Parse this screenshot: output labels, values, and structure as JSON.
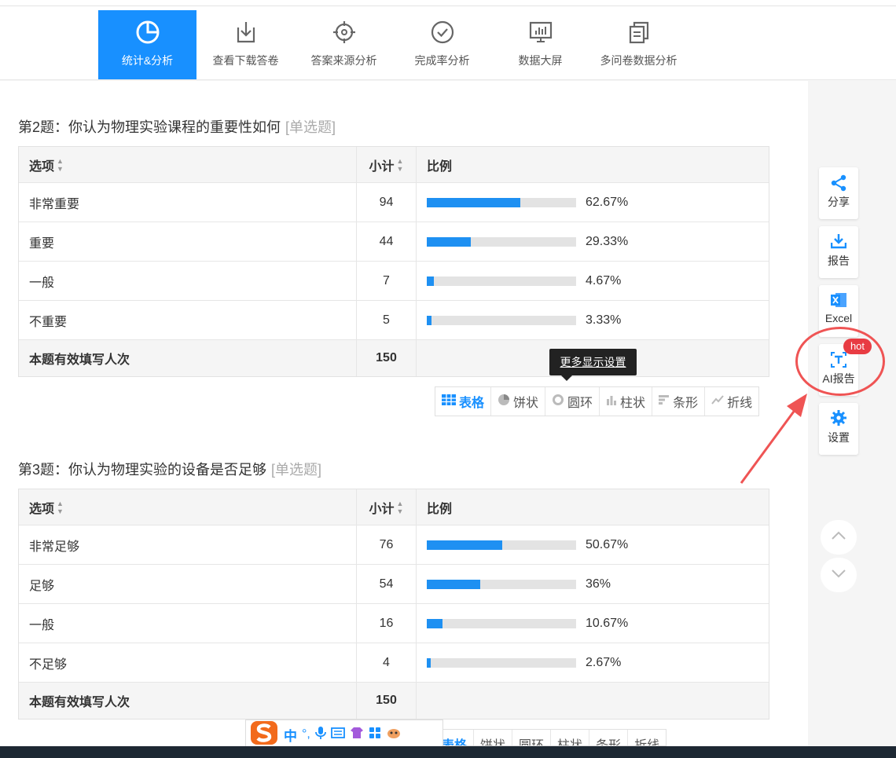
{
  "nav": {
    "items": [
      {
        "label": "统计&分析",
        "icon": "pie-chart-icon",
        "active": true
      },
      {
        "label": "查看下载答卷",
        "icon": "download-icon",
        "active": false
      },
      {
        "label": "答案来源分析",
        "icon": "crosshair-icon",
        "active": false
      },
      {
        "label": "完成率分析",
        "icon": "check-circle-icon",
        "active": false
      },
      {
        "label": "数据大屏",
        "icon": "monitor-chart-icon",
        "active": false
      },
      {
        "label": "多问卷数据分析",
        "icon": "copy-docs-icon",
        "active": false
      }
    ]
  },
  "questions": [
    {
      "title": "第2题：你认为物理实验课程的重要性如何",
      "type": "[单选题]",
      "headers": {
        "option": "选项",
        "count": "小计",
        "ratio": "比例"
      },
      "rows": [
        {
          "option": "非常重要",
          "count": "94",
          "percent": "62.67%",
          "fraction": 0.6267
        },
        {
          "option": "重要",
          "count": "44",
          "percent": "29.33%",
          "fraction": 0.2933
        },
        {
          "option": "一般",
          "count": "7",
          "percent": "4.67%",
          "fraction": 0.0467
        },
        {
          "option": "不重要",
          "count": "5",
          "percent": "3.33%",
          "fraction": 0.0333
        }
      ],
      "footer": {
        "label": "本题有效填写人次",
        "count": "150"
      }
    },
    {
      "title": "第3题：你认为物理实验的设备是否足够",
      "type": "[单选题]",
      "headers": {
        "option": "选项",
        "count": "小计",
        "ratio": "比例"
      },
      "rows": [
        {
          "option": "非常足够",
          "count": "76",
          "percent": "50.67%",
          "fraction": 0.5067
        },
        {
          "option": "足够",
          "count": "54",
          "percent": "36%",
          "fraction": 0.36
        },
        {
          "option": "一般",
          "count": "16",
          "percent": "10.67%",
          "fraction": 0.1067
        },
        {
          "option": "不足够",
          "count": "4",
          "percent": "2.67%",
          "fraction": 0.0267
        }
      ],
      "footer": {
        "label": "本题有效填写人次",
        "count": "150"
      }
    }
  ],
  "chart_tabs": [
    {
      "label": "表格",
      "icon": "table-icon",
      "active": true
    },
    {
      "label": "饼状",
      "icon": "pie-icon",
      "active": false
    },
    {
      "label": "圆环",
      "icon": "donut-icon",
      "active": false
    },
    {
      "label": "柱状",
      "icon": "column-icon",
      "active": false
    },
    {
      "label": "条形",
      "icon": "bar-icon",
      "active": false
    },
    {
      "label": "折线",
      "icon": "line-icon",
      "active": false
    }
  ],
  "tooltip": "更多显示设置",
  "sidebar": {
    "share": "分享",
    "report": "报告",
    "excel": "Excel",
    "ai_report": "AI报告",
    "hot_badge": "hot",
    "settings": "设置"
  },
  "ime": {
    "label": "中"
  },
  "colors": {
    "accent": "#1890ff",
    "bar": "#1e90f2",
    "hot": "#e83c43",
    "highlight_ring": "#ef5454"
  }
}
